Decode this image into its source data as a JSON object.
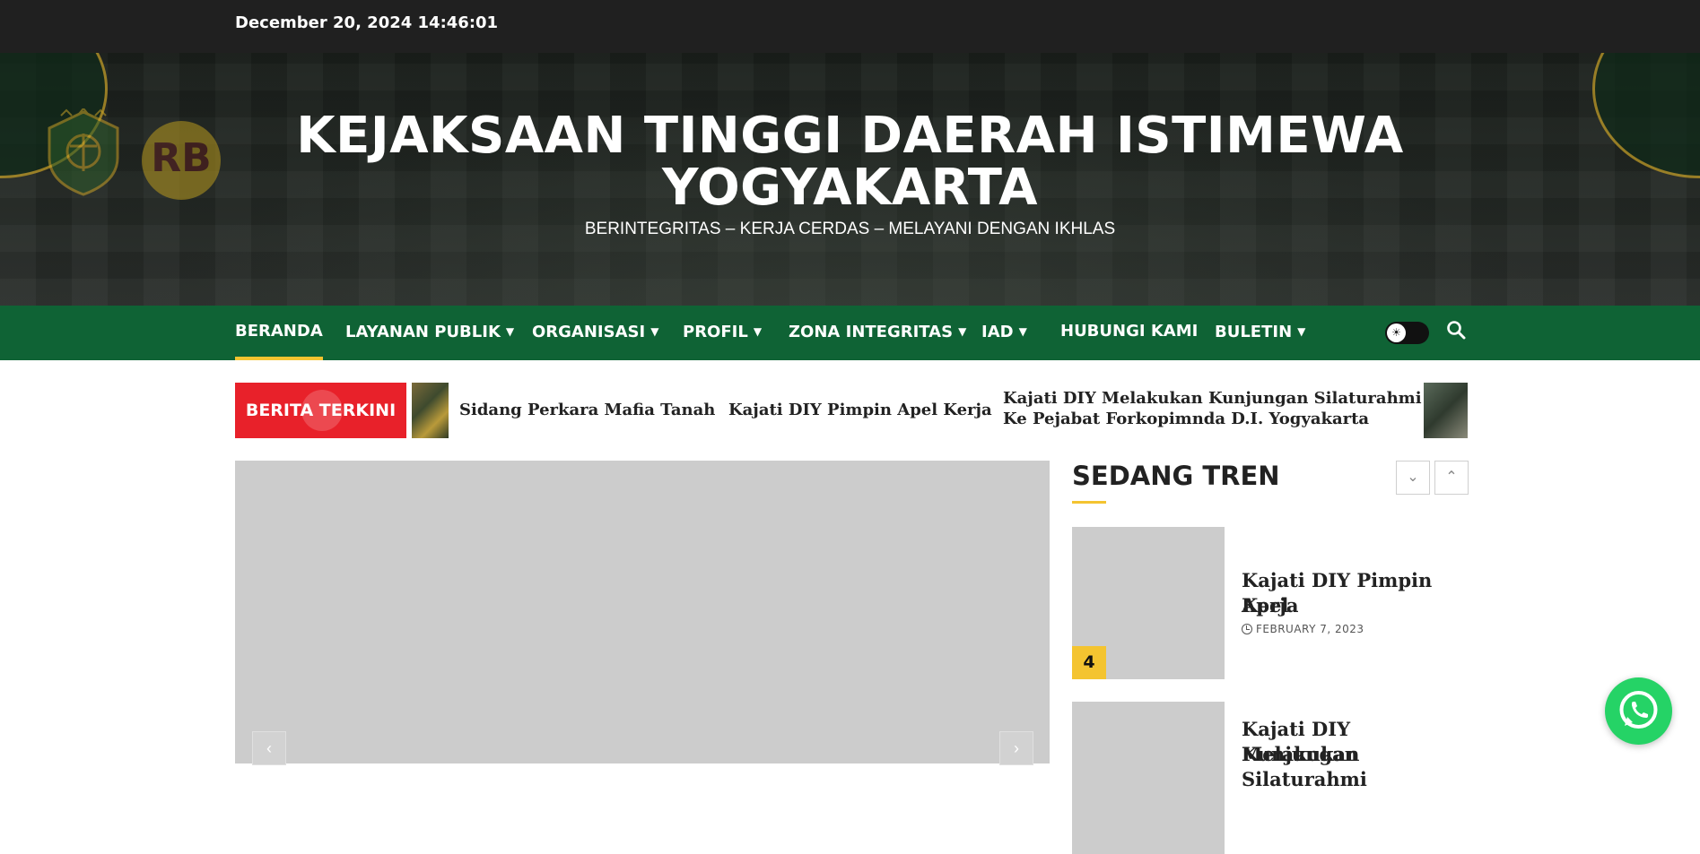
{
  "topbar": {
    "datetime": "December 20, 2024 14:46:01"
  },
  "header": {
    "title": "KEJAKSAAN TINGGI DAERAH ISTIMEWA YOGYAKARTA",
    "tagline": "BERINTEGRITAS – KERJA CERDAS – MELAYANI DENGAN IKHLAS",
    "rb_logo_text": "RB"
  },
  "nav": {
    "items": [
      {
        "label": "BERANDA",
        "has_dropdown": false,
        "active": true
      },
      {
        "label": "LAYANAN PUBLIK",
        "has_dropdown": true
      },
      {
        "label": "ORGANISASI",
        "has_dropdown": true
      },
      {
        "label": "PROFIL",
        "has_dropdown": true
      },
      {
        "label": "ZONA INTEGRITAS",
        "has_dropdown": true
      },
      {
        "label": "IAD",
        "has_dropdown": true
      },
      {
        "label": "HUBUNGI KAMI",
        "has_dropdown": false
      },
      {
        "label": "BULETIN",
        "has_dropdown": true
      }
    ],
    "chevron": "⌄",
    "theme_toggle_icon": "sun-icon",
    "search_icon": "search-icon"
  },
  "ticker": {
    "label": "BERITA TERKINI",
    "items": [
      "Sidang Perkara Mafia Tanah",
      "Kajati DIY Pimpin Apel Kerja",
      "Kajati DIY Melakukan Kunjungan Silaturahmi",
      "Ke Pejabat Forkopimnda D.I. Yogyakarta"
    ]
  },
  "slider": {
    "prev": "‹",
    "next": "›"
  },
  "trending": {
    "title": "SEDANG TREN",
    "down": "⌄",
    "up": "⌃",
    "items": [
      {
        "rank": "4",
        "headline_1": "Kajati DIY Pimpin Apel",
        "headline_2": "Kerja",
        "date": "FEBRUARY 7, 2023"
      },
      {
        "headline_1": "Kajati DIY Melakukan",
        "headline_2": "Kunjungan Silaturahmi"
      }
    ]
  },
  "colors": {
    "nav_green": "#0f6335",
    "accent_yellow": "#f4c430",
    "ticker_red": "#e8212a",
    "whatsapp_green": "#25d366"
  }
}
